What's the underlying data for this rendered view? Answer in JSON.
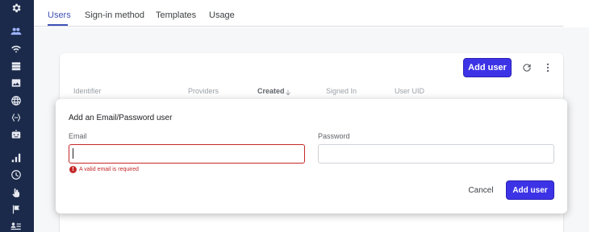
{
  "tabs": [
    {
      "label": "Users"
    },
    {
      "label": "Sign-in method"
    },
    {
      "label": "Templates"
    },
    {
      "label": "Usage"
    }
  ],
  "toolbar": {
    "add_user_label": "Add user",
    "refresh_icon": "refresh-icon",
    "more_icon": "more-vert-icon"
  },
  "table": {
    "columns": [
      "Identifier",
      "Providers",
      "Created",
      "Signed In",
      "User UID"
    ],
    "sorted_column": "Created"
  },
  "dialog": {
    "title": "Add an Email/Password user",
    "email_label": "Email",
    "email_value": "",
    "password_label": "Password",
    "password_value": "",
    "email_error": "A valid email is required",
    "cancel_label": "Cancel",
    "submit_label": "Add user"
  },
  "sidebar": {
    "icons": [
      "settings-icon",
      "users-icon",
      "realtime-icon",
      "storage-icon",
      "hosting-icon",
      "web-icon",
      "functions-icon",
      "ml-icon",
      "analytics-icon",
      "history-icon",
      "touch-icon",
      "flag-icon",
      "list-icon"
    ],
    "active": "users-icon"
  },
  "colors": {
    "rail_bg": "#1b2a4a",
    "accent": "#3f51b5",
    "primary_button": "#3d33e6",
    "error": "#c62828"
  }
}
